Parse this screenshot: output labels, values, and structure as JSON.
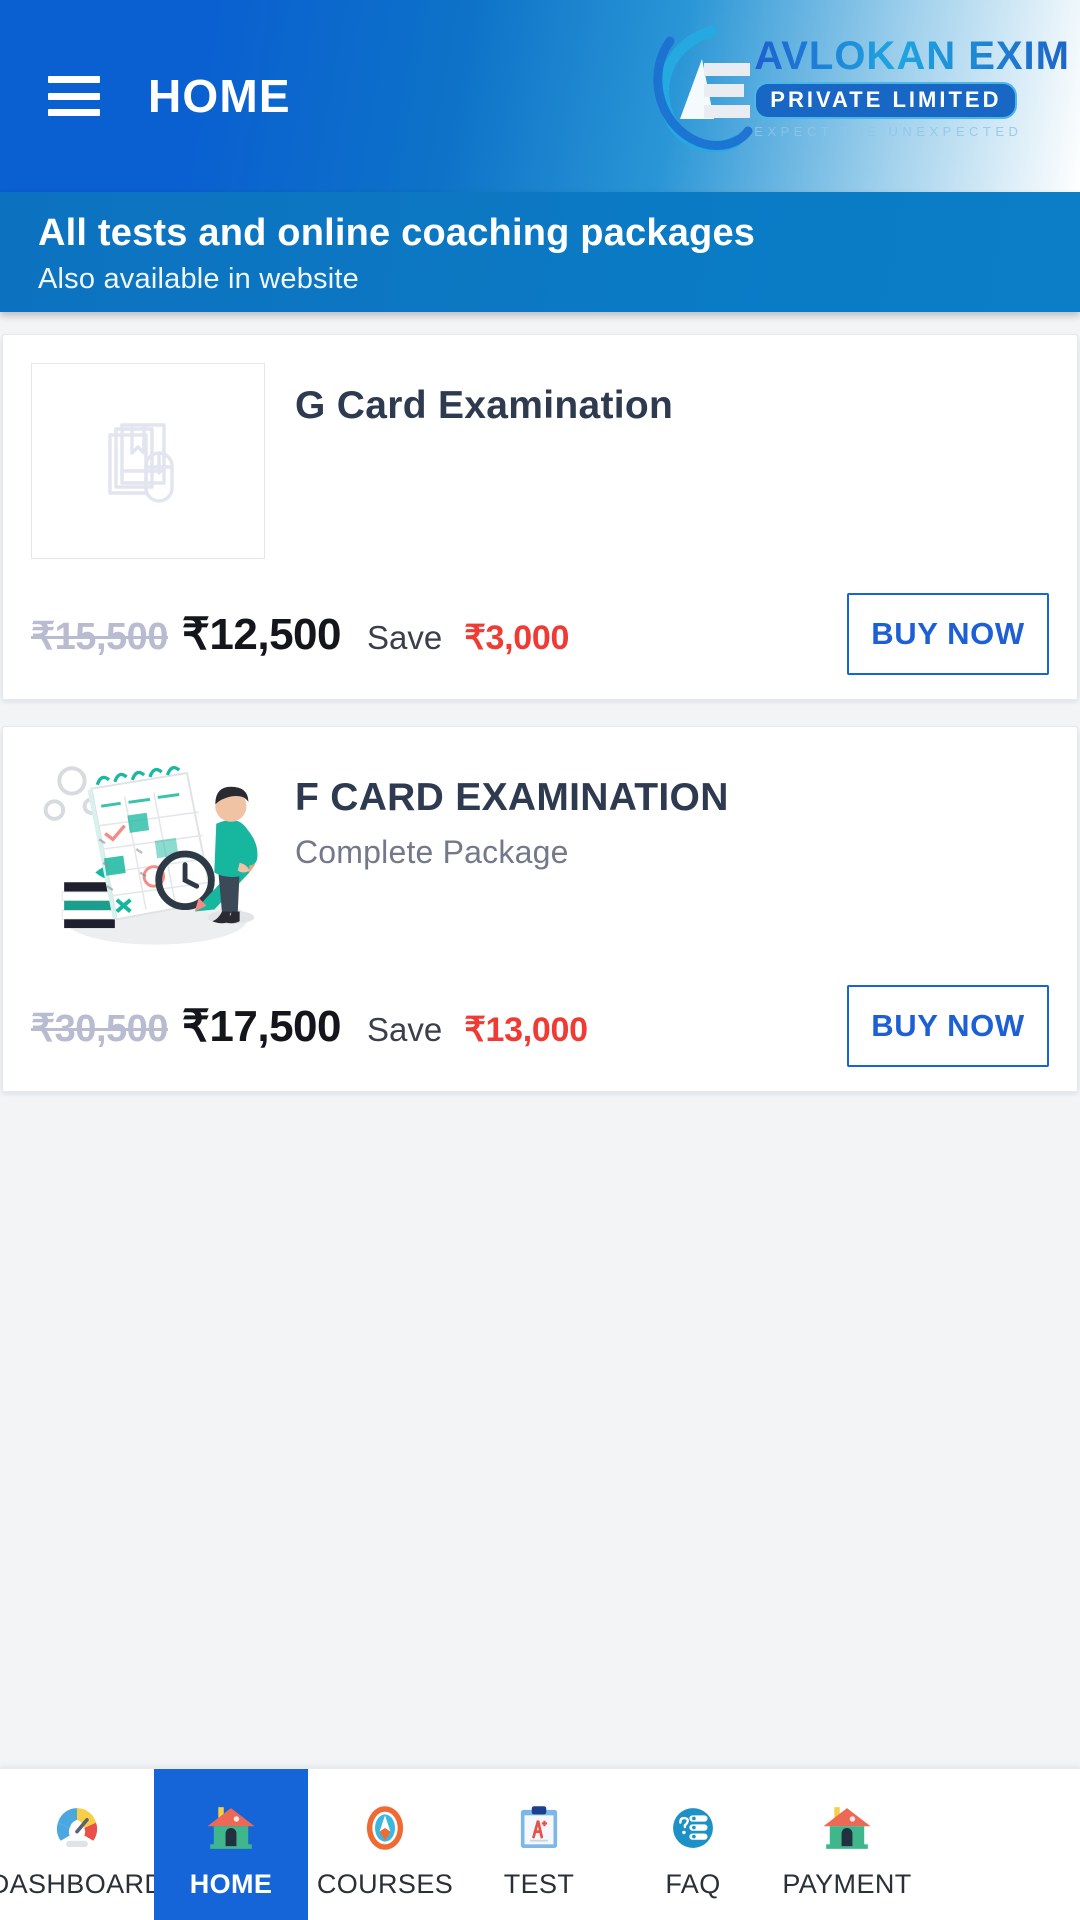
{
  "appbar": {
    "menu_icon": "hamburger-menu-icon",
    "title": "HOME",
    "logo": {
      "mark": "ae-monogram-icon",
      "name": "AVLOKAN EXIM",
      "sub": "PRIVATE LIMITED",
      "tagline": "EXPECT THE UNEXPECTED"
    }
  },
  "banner": {
    "title": "All tests and online coaching packages",
    "subtitle": "Also available in website"
  },
  "cards": [
    {
      "title": "G Card Examination",
      "subtitle": "",
      "thumb_icon": "book-and-mouse-placeholder-icon",
      "price_old": "₹15,500",
      "price_new": "₹12,500",
      "save_label": "Save",
      "save_amount": "₹3,000",
      "buy_label": "BUY NOW"
    },
    {
      "title": "F CARD EXAMINATION",
      "subtitle": "Complete Package",
      "thumb_icon": "calendar-planner-illustration",
      "price_old": "₹30,500",
      "price_new": "₹17,500",
      "save_label": "Save",
      "save_amount": "₹13,000",
      "buy_label": "BUY NOW"
    }
  ],
  "bottom_nav": {
    "active_index": 1,
    "items": [
      {
        "label": "DASHBOARD",
        "icon": "gauge-icon"
      },
      {
        "label": "HOME",
        "icon": "house-icon"
      },
      {
        "label": "COURSES",
        "icon": "compass-icon"
      },
      {
        "label": "TEST",
        "icon": "clipboard-grade-icon"
      },
      {
        "label": "FAQ",
        "icon": "question-list-icon"
      },
      {
        "label": "PAYMENT",
        "icon": "house-icon"
      }
    ]
  },
  "colors": {
    "primary_blue": "#1565d8",
    "banner_blue": "#0c77c2",
    "save_red": "#ef3b33",
    "price_old_gray": "#b9bcd0",
    "title_dark": "#2e3a4f"
  }
}
